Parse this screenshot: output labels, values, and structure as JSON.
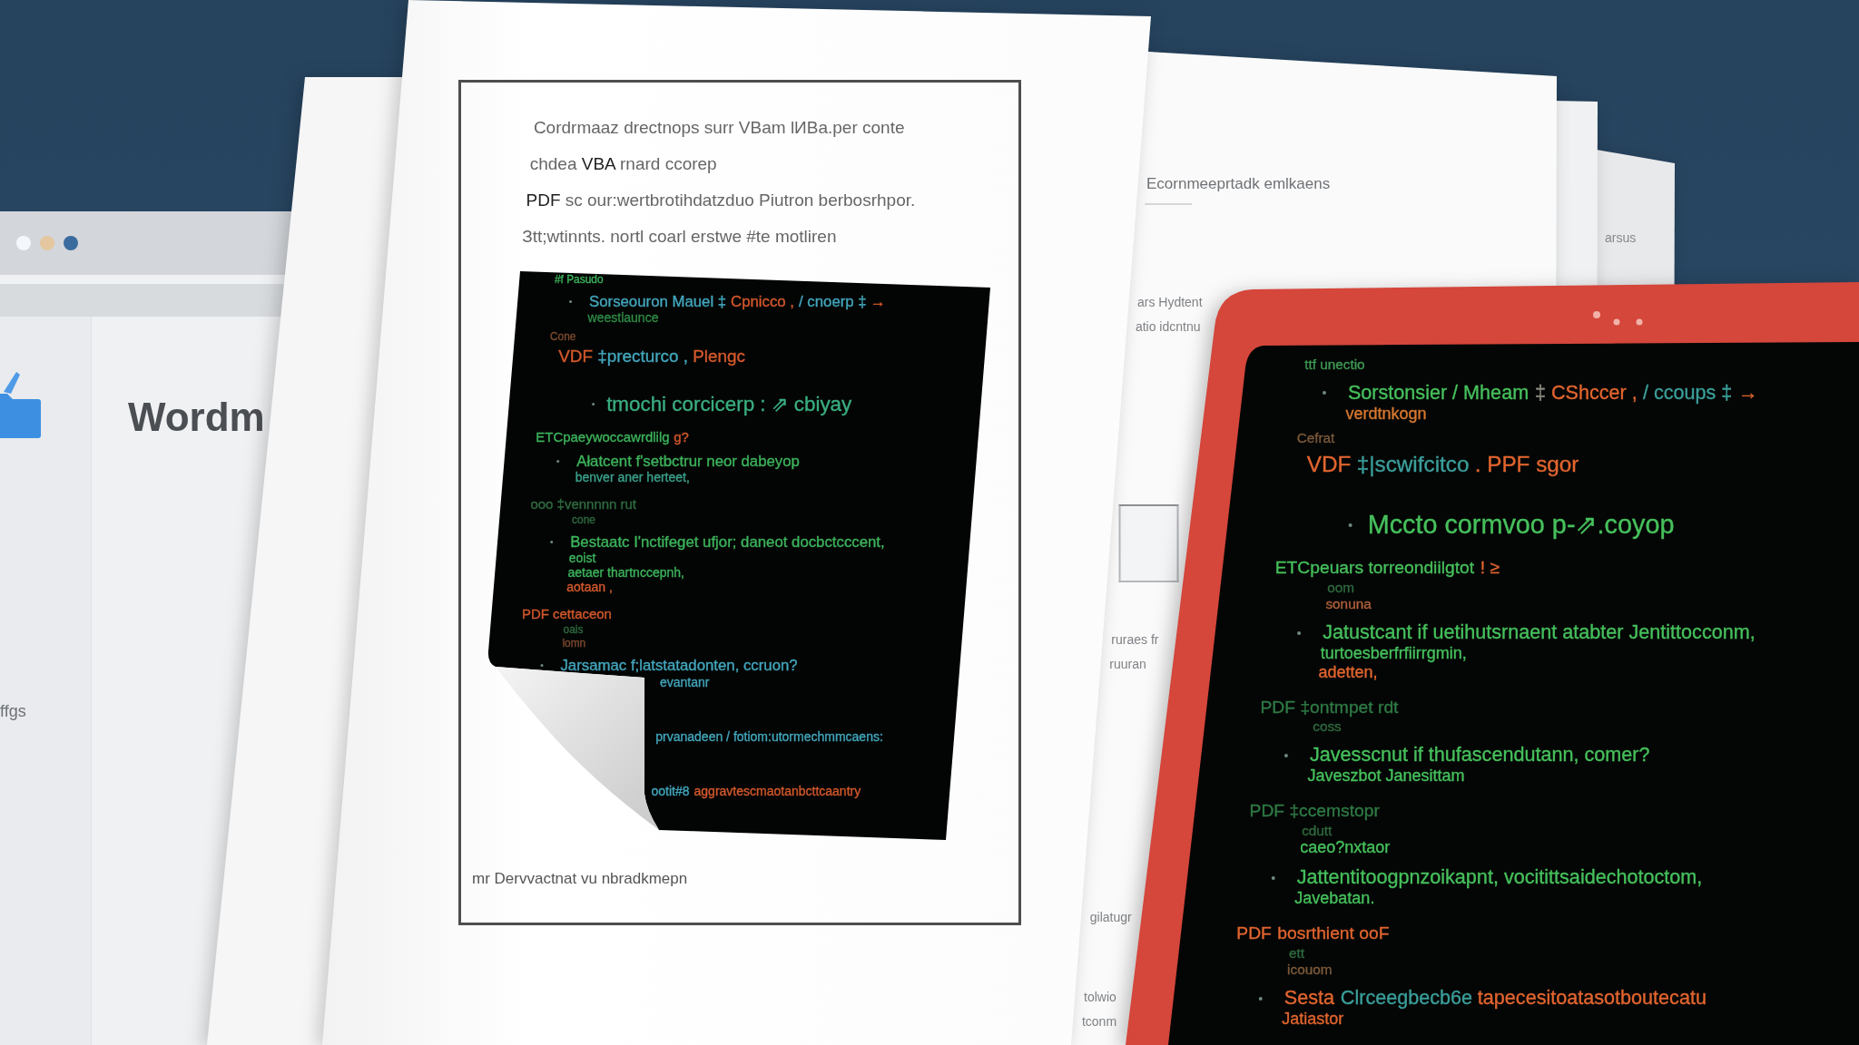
{
  "app_window": {
    "controls": [
      {
        "color": "#f4f8fc"
      },
      {
        "color": "#e4c79e"
      },
      {
        "color": "#3a6b9e"
      }
    ],
    "sidebar_label": "ffgs",
    "heading": "Wordm"
  },
  "document": {
    "intro": [
      "Cordrmaaz drectnops surr VBam lИBa.per conte",
      "chdea **VBA** rnard ccorep",
      "**PDF** sc our:wertbrotihdatzduo Piutron berbosrhpor.",
      "Зtt;wtinnts. nortl coarl erstwe #te motliren"
    ],
    "code": [
      {
        "kind": "note",
        "segments": [
          {
            "text": "#f Pasudo",
            "color": "#3db45c"
          }
        ]
      },
      {
        "kind": "item",
        "segments": [
          {
            "text": "Sorseouron Mauel ‡",
            "color": "#43a6bd"
          },
          {
            "text": "Cpnicco ,",
            "color": "#d3582c"
          },
          {
            "text": "/ cnoerp ‡",
            "color": "#43a6bd"
          },
          {
            "text": "→",
            "color": "#d3582c"
          }
        ]
      },
      {
        "kind": "sub",
        "segments": [
          {
            "text": "weestlaunce",
            "color": "#2f8a45"
          }
        ]
      },
      {
        "kind": "note",
        "segments": [
          {
            "text": "Cone",
            "color": "#7d4a2f"
          }
        ]
      },
      {
        "kind": "head",
        "segments": [
          {
            "text": "VDF",
            "color": "#d3582c"
          },
          {
            "text": "‡precturco ,",
            "color": "#43a6bd"
          },
          {
            "text": "Plengc",
            "color": "#d3582c"
          }
        ]
      },
      {
        "kind": "big",
        "segments": [
          {
            "text": "tmochi corcicerp : ⇗ cbiyay",
            "color": "#3aae80"
          }
        ]
      },
      {
        "kind": "section",
        "segments": [
          {
            "text": "ЕТСpaeywoccawrdlilg",
            "color": "#3db45c"
          },
          {
            "text": "g?",
            "color": "#d3582c"
          }
        ]
      },
      {
        "kind": "item",
        "segments": [
          {
            "text": "Ałatcent f'setbctrur neor dabeyop",
            "color": "#3db45c"
          }
        ]
      },
      {
        "kind": "sub",
        "segments": [
          {
            "text": "benver aner herteet,",
            "color": "#3aa08a"
          }
        ]
      },
      {
        "kind": "section",
        "segments": [
          {
            "text": "ooo ‡vennnnn rut",
            "color": "#2f6b40"
          }
        ]
      },
      {
        "kind": "label",
        "segments": [
          {
            "text": "cone",
            "color": "#2f6b40"
          }
        ]
      },
      {
        "kind": "item",
        "segments": [
          {
            "text": "Bestaatc I'nctifeget ufjor; daneot docbctcccent,",
            "color": "#3db45c"
          }
        ]
      },
      {
        "kind": "sub",
        "segments": [
          {
            "text": "eoist",
            "color": "#3db45c"
          }
        ]
      },
      {
        "kind": "sub",
        "segments": [
          {
            "text": "aetaer thartnccepnh,",
            "color": "#3db45c"
          }
        ]
      },
      {
        "kind": "sub",
        "segments": [
          {
            "text": "aotaan ,",
            "color": "#d3582c"
          }
        ]
      },
      {
        "kind": "section",
        "segments": [
          {
            "text": "PDF cettaceon",
            "color": "#d3582c"
          }
        ]
      },
      {
        "kind": "label",
        "segments": [
          {
            "text": "oais",
            "color": "#2f6b40"
          }
        ]
      },
      {
        "kind": "label",
        "segments": [
          {
            "text": "lomn",
            "color": "#7d4a2f"
          }
        ]
      },
      {
        "kind": "item",
        "segments": [
          {
            "text": "Jarsamac f;latstatadonten, ccruon?",
            "color": "#43a6bd"
          }
        ]
      },
      {
        "kind": "tail",
        "segments": [
          {
            "text": "evantanr",
            "color": "#43a6bd"
          }
        ]
      },
      {
        "kind": "footer",
        "segments": [
          {
            "text": "prvanadeen / fotiom:utormechmmcaens:",
            "color": "#43a6bd"
          }
        ]
      },
      {
        "kind": "footer",
        "segments": [
          {
            "text": "ootit#8",
            "color": "#43a6bd"
          },
          {
            "text": "aggravtescmaotanbcttcaantry",
            "color": "#d3582c"
          }
        ]
      }
    ],
    "caption": "mr Dervvactnat vu nbradkmepn"
  },
  "back_pages": {
    "fragments": [
      {
        "kind": "title",
        "lines": [
          "Ecornmeeprtadk emlkaens"
        ]
      },
      {
        "kind": "para",
        "lines": [
          "ars Hydtent",
          "atio idcntnu"
        ]
      },
      {
        "kind": "frame"
      },
      {
        "kind": "para",
        "lines": [
          "ruraes fr",
          "ruuran"
        ]
      },
      {
        "kind": "para",
        "lines": [
          "gilatugr"
        ]
      },
      {
        "kind": "para",
        "lines": [
          "tolwio",
          "tconm"
        ]
      }
    ],
    "edge_text": "arsus"
  },
  "tablet": {
    "code": [
      {
        "kind": "note",
        "segments": [
          {
            "text": "ttf unectio",
            "color": "#3f9a55"
          }
        ]
      },
      {
        "kind": "item",
        "segments": [
          {
            "text": "Sorstonsier / Mheam",
            "color": "#46c05c"
          },
          {
            "text": "‡",
            "color": "#8a8a80"
          },
          {
            "text": "CShccer ,",
            "color": "#e2652f"
          },
          {
            "text": "/ ccoups ‡",
            "color": "#3b9e9a"
          },
          {
            "text": "→",
            "color": "#e2652f"
          }
        ]
      },
      {
        "kind": "sub",
        "segments": [
          {
            "text": "verdtnkogn",
            "color": "#d8782f"
          }
        ]
      },
      {
        "kind": "note",
        "segments": [
          {
            "text": "Cefrat",
            "color": "#7d5a3a"
          }
        ]
      },
      {
        "kind": "head",
        "segments": [
          {
            "text": "VDF",
            "color": "#e2652f"
          },
          {
            "text": "‡|scwifcitco",
            "color": "#3b9e9a"
          },
          {
            "text": ". PPF sgor",
            "color": "#e2652f"
          }
        ]
      },
      {
        "kind": "big",
        "segments": [
          {
            "text": "Mccto cormvoo p-⇗.coyop",
            "color": "#46c05c"
          }
        ]
      },
      {
        "kind": "section",
        "segments": [
          {
            "text": "ЕТСpeuars torreondiilgtot",
            "color": "#46c05c"
          },
          {
            "text": "! ≥",
            "color": "#e2652f"
          }
        ]
      },
      {
        "kind": "label",
        "segments": [
          {
            "text": "oom",
            "color": "#2f6a3e"
          }
        ]
      },
      {
        "kind": "label",
        "segments": [
          {
            "text": "sonuna",
            "color": "#b0603a"
          }
        ]
      },
      {
        "kind": "item",
        "segments": [
          {
            "text": "Jatustcant if uetihutsrnaent atabter Jentittocconm,",
            "color": "#46c05c"
          }
        ]
      },
      {
        "kind": "sub",
        "segments": [
          {
            "text": "turtoesberfrfiirrgmin,",
            "color": "#46c05c"
          }
        ]
      },
      {
        "kind": "sub",
        "segments": [
          {
            "text": "adetten,",
            "color": "#e2652f"
          }
        ]
      },
      {
        "kind": "section",
        "segments": [
          {
            "text": "PDF ‡ontmpet rdt",
            "color": "#2f7a45"
          }
        ]
      },
      {
        "kind": "label",
        "segments": [
          {
            "text": "coss",
            "color": "#2f6a3e"
          }
        ]
      },
      {
        "kind": "item",
        "segments": [
          {
            "text": "Javesscnut if thufascendutann, comer?",
            "color": "#46c05c"
          }
        ]
      },
      {
        "kind": "sub",
        "segments": [
          {
            "text": "Javeszbot Janesittam",
            "color": "#46c05c"
          }
        ]
      },
      {
        "kind": "section",
        "segments": [
          {
            "text": "PDF ‡ccemstopr",
            "color": "#2f7a45"
          }
        ]
      },
      {
        "kind": "label",
        "segments": [
          {
            "text": "cdutt",
            "color": "#2f6a3e"
          }
        ]
      },
      {
        "kind": "sub",
        "segments": [
          {
            "text": "caeo?nxtaor",
            "color": "#46c05c"
          }
        ]
      },
      {
        "kind": "item",
        "segments": [
          {
            "text": "Jattentitoogpnzoikapnt, vocitittsaidechotoctom,",
            "color": "#46c05c"
          }
        ]
      },
      {
        "kind": "sub",
        "segments": [
          {
            "text": "Javebatan.",
            "color": "#46c05c"
          }
        ]
      },
      {
        "kind": "section",
        "segments": [
          {
            "text": "PDF",
            "color": "#e2652f"
          },
          {
            "text": "bosrthient ooF",
            "color": "#e2652f"
          }
        ]
      },
      {
        "kind": "label",
        "segments": [
          {
            "text": "ett",
            "color": "#2f6a3e"
          }
        ]
      },
      {
        "kind": "label",
        "segments": [
          {
            "text": "icouom",
            "color": "#7d5a3a"
          }
        ]
      },
      {
        "kind": "item",
        "segments": [
          {
            "text": "Sesta",
            "color": "#e2652f"
          },
          {
            "text": "Clrceegbecb6e",
            "color": "#3b9e9a"
          },
          {
            "text": "tapecesitoatasotboutecatu",
            "color": "#e2652f"
          }
        ]
      },
      {
        "kind": "sub",
        "segments": [
          {
            "text": "Jatiastor",
            "color": "#e2652f"
          }
        ]
      }
    ]
  }
}
